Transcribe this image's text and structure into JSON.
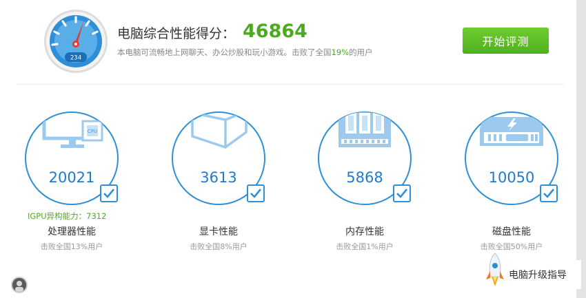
{
  "header": {
    "gauge_digits": "234",
    "score_title": "电脑综合性能得分：",
    "score_value": "46864",
    "desc_prefix": "本电脑可流畅地上网聊天、办公炒股和玩小游戏。击败了全国",
    "desc_percent": "19%",
    "desc_suffix": "的用户",
    "start_button_label": "开始评测"
  },
  "cards": [
    {
      "value": "20021",
      "label": "处理器性能",
      "sub": "击败全国13%用户",
      "icon": "monitor-cpu-icon",
      "chip_label": "CPU"
    },
    {
      "value": "3613",
      "label": "显卡性能",
      "sub": "击败全国8%用户",
      "icon": "cube-icon"
    },
    {
      "value": "5868",
      "label": "内存性能",
      "sub": "击败全国1%用户",
      "icon": "memory-chip-icon"
    },
    {
      "value": "10050",
      "label": "磁盘性能",
      "sub": "击败全国50%用户",
      "icon": "hard-disk-icon"
    }
  ],
  "igpu_label": "IGPU异构能力：7312",
  "upgrade_guide_label": "电脑升级指导",
  "colors": {
    "accent_blue": "#2d8fd6",
    "value_blue": "#1d7ad1",
    "green": "#4caa1f",
    "needle_red": "#e8392b"
  }
}
